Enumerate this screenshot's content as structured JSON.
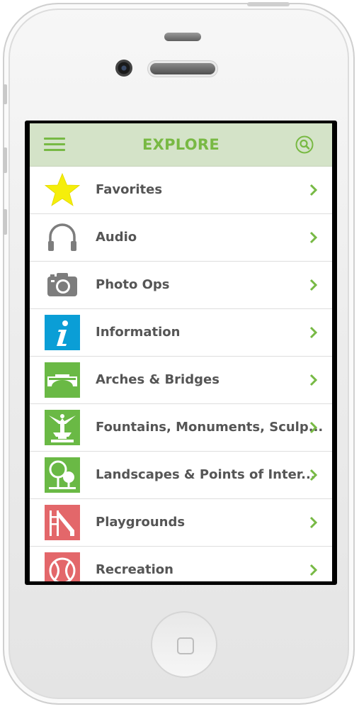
{
  "header": {
    "title": "EXPLORE"
  },
  "colors": {
    "accent": "#78b943",
    "header_bg": "#d4e3c8",
    "info_blue": "#0a9ed6",
    "green_tile": "#6ab945",
    "red_tile": "#e3676a"
  },
  "items": [
    {
      "label": "Favorites",
      "icon": "star-icon"
    },
    {
      "label": "Audio",
      "icon": "headphones-icon"
    },
    {
      "label": "Photo Ops",
      "icon": "camera-icon"
    },
    {
      "label": "Information",
      "icon": "info-icon"
    },
    {
      "label": "Arches & Bridges",
      "icon": "bridge-icon"
    },
    {
      "label": "Fountains, Monuments, Sculp...",
      "icon": "fountain-statue-icon"
    },
    {
      "label": "Landscapes & Points of Inter...",
      "icon": "tree-icon"
    },
    {
      "label": "Playgrounds",
      "icon": "playground-slide-icon"
    },
    {
      "label": "Recreation",
      "icon": "ball-icon"
    }
  ]
}
